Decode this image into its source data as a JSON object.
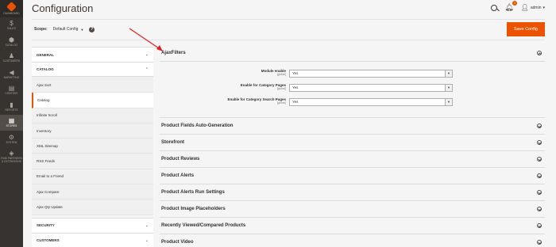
{
  "rail": [
    {
      "label": "DASHBOARD",
      "icon": "logo-icon"
    },
    {
      "label": "SALES",
      "icon": "$"
    },
    {
      "label": "CATALOG",
      "icon": "⬢"
    },
    {
      "label": "CUSTOMERS",
      "icon": "♟"
    },
    {
      "label": "MARKETING",
      "icon": "📣"
    },
    {
      "label": "CONTENT",
      "icon": "▤"
    },
    {
      "label": "REPORTS",
      "icon": "▮"
    },
    {
      "label": "STORES",
      "icon": "▦"
    },
    {
      "label": "SYSTEM",
      "icon": "⚙"
    },
    {
      "label": "FIND PARTNERS & EXTENSIONS",
      "icon": "◈"
    }
  ],
  "header": {
    "title": "Configuration",
    "notifications_count": "1",
    "user": "admin"
  },
  "scope": {
    "label": "Scope:",
    "value": "Default Config",
    "help": "?",
    "save_label": "Save Config"
  },
  "nav": {
    "groups": [
      {
        "title": "GENERAL"
      },
      {
        "title": "CATALOG"
      },
      {
        "title": "SECURITY"
      },
      {
        "title": "CUSTOMERS"
      }
    ],
    "catalog_items": [
      "Ajax Sort",
      "Catalog",
      "Infinite Scroll",
      "Inventory",
      "XML Sitemap",
      "RSS Feeds",
      "Email to a Friend",
      "Ajax Compare",
      "Ajax Qty Update"
    ]
  },
  "main": {
    "ajax_title": "AjaxFilters",
    "fields": [
      {
        "label": "Module enable",
        "scope": "[global]",
        "value": "Yes"
      },
      {
        "label": "Enable for Category Pages",
        "scope": "[global]",
        "value": "Yes"
      },
      {
        "label": "Enable for Category Search Pages",
        "scope": "[global]",
        "value": "Yes"
      }
    ],
    "sections": [
      "Product Fields Auto-Generation",
      "Storefront",
      "Product Reviews",
      "Product Alerts",
      "Product Alerts Run Settings",
      "Product Image Placeholders",
      "Recently Viewed/Compared Products",
      "Product Video"
    ]
  },
  "colors": {
    "accent": "#eb5202",
    "rail": "#373330",
    "annotation_arrow": "#e02020"
  }
}
